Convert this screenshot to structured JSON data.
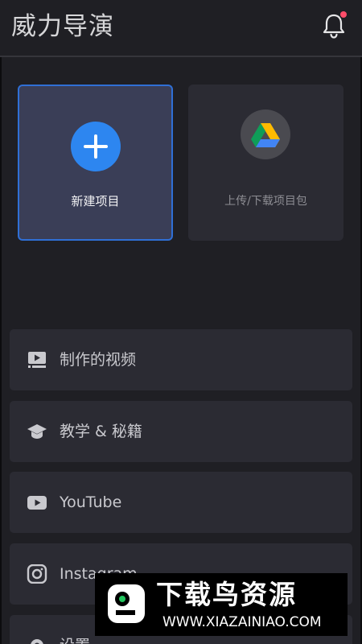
{
  "header": {
    "title": "威力导演",
    "notification_icon": "bell-icon",
    "notification_dot_color": "#ff4d6a"
  },
  "cards": {
    "new_project": {
      "label": "新建项目",
      "icon": "plus-icon",
      "accent": "#2d86f0"
    },
    "upload_download": {
      "label": "上传/下载项目包",
      "icon": "google-drive-icon"
    }
  },
  "menu": {
    "items": [
      {
        "label": "制作的视频",
        "icon": "video-library-icon"
      },
      {
        "label": "教学 & 秘籍",
        "icon": "graduation-cap-icon"
      },
      {
        "label": "YouTube",
        "icon": "youtube-icon"
      },
      {
        "label": "Instagram",
        "icon": "instagram-icon"
      },
      {
        "label": "设置",
        "icon": "gear-icon"
      }
    ]
  },
  "watermark": {
    "title": "下载鸟资源",
    "url": "WWW.XIAZAINIAO.COM"
  }
}
